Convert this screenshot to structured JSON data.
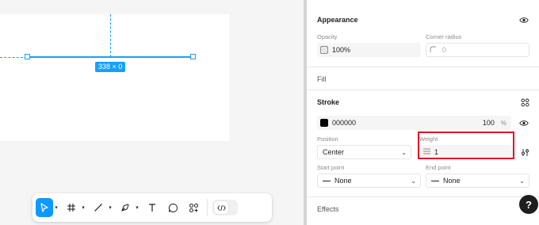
{
  "canvas": {
    "dimension_badge": "338 × 0"
  },
  "toolbar": {
    "tools": [
      {
        "name": "move-tool",
        "icon": "pointer-icon",
        "active": true,
        "has_caret": true
      },
      {
        "name": "frame-tool",
        "icon": "hash-frame-icon",
        "has_caret": true
      },
      {
        "name": "line-tool",
        "icon": "line-icon",
        "has_caret": true
      },
      {
        "name": "pen-tool",
        "icon": "pen-icon",
        "has_caret": true
      },
      {
        "name": "text-tool",
        "icon": "text-icon",
        "has_caret": false
      },
      {
        "name": "comment-tool",
        "icon": "comment-icon",
        "has_caret": false
      },
      {
        "name": "actions-tool",
        "icon": "actions-icon",
        "has_caret": false
      }
    ],
    "dev_mode_icon": "code-icon"
  },
  "panel": {
    "appearance": {
      "title": "Appearance",
      "opacity_label": "Opacity",
      "opacity_value": "100%",
      "corner_radius_label": "Corner radius",
      "corner_radius_value": "0"
    },
    "fill": {
      "title": "Fill"
    },
    "stroke": {
      "title": "Stroke",
      "color_hex": "000000",
      "color_opacity": "100",
      "opacity_unit": "%",
      "position_label": "Position",
      "position_value": "Center",
      "weight_label": "Weight",
      "weight_value": "1",
      "start_point_label": "Start point",
      "start_point_value": "Line None",
      "end_point_label": "End point",
      "end_point_value": "Line None",
      "start_point_text": "None",
      "end_point_text": "None"
    },
    "effects": {
      "title": "Effects"
    }
  },
  "help_label": "?",
  "colors": {
    "accent": "#0d99ff",
    "highlight": "#e0112b",
    "swatch": "#000000"
  }
}
